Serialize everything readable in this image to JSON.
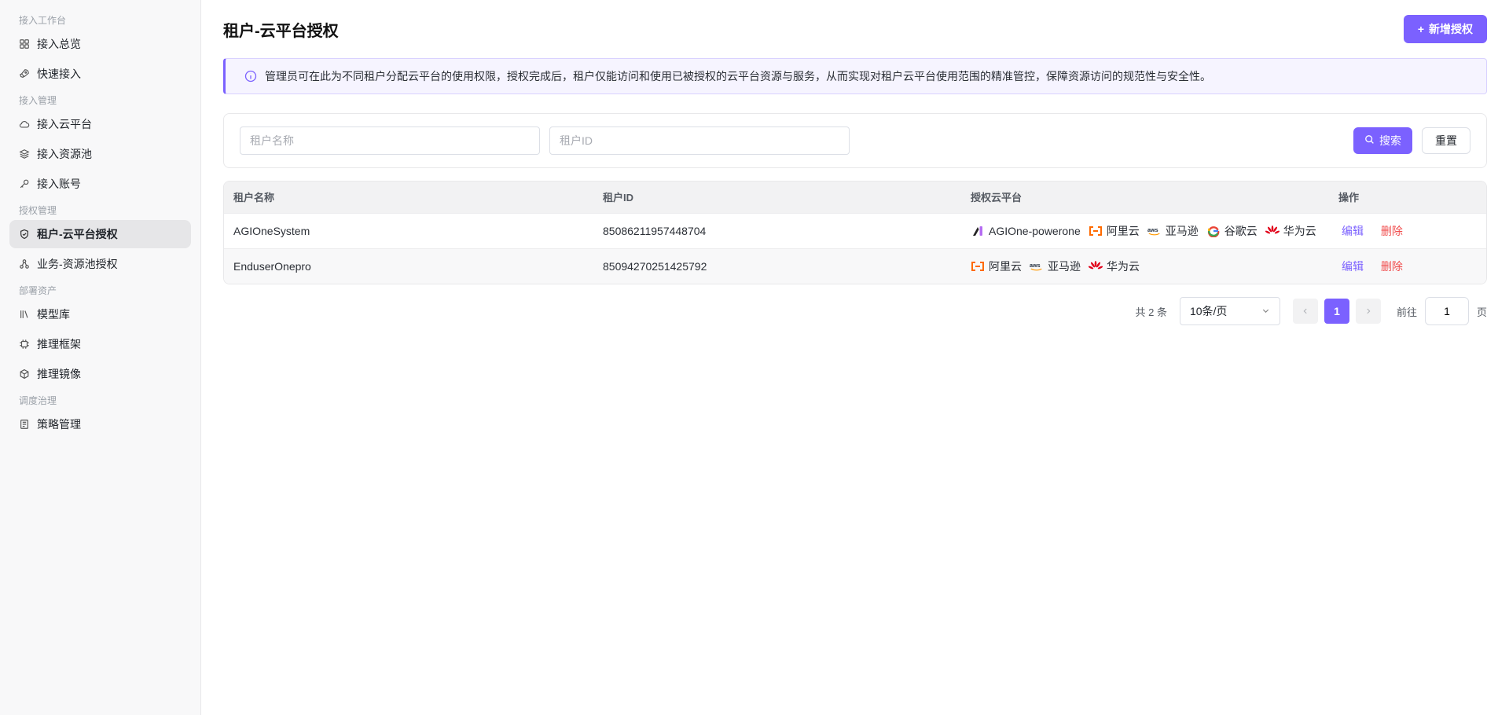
{
  "sidebar": {
    "groups": [
      {
        "title": "接入工作台",
        "items": [
          {
            "label": "接入总览",
            "icon": "grid-icon"
          },
          {
            "label": "快速接入",
            "icon": "rocket-icon"
          }
        ]
      },
      {
        "title": "接入管理",
        "items": [
          {
            "label": "接入云平台",
            "icon": "cloud-icon"
          },
          {
            "label": "接入资源池",
            "icon": "layers-icon"
          },
          {
            "label": "接入账号",
            "icon": "key-icon"
          }
        ]
      },
      {
        "title": "授权管理",
        "items": [
          {
            "label": "租户-云平台授权",
            "icon": "shield-icon",
            "active": true
          },
          {
            "label": "业务-资源池授权",
            "icon": "nodes-icon"
          }
        ]
      },
      {
        "title": "部署资产",
        "items": [
          {
            "label": "模型库",
            "icon": "library-icon"
          },
          {
            "label": "推理框架",
            "icon": "chip-icon"
          },
          {
            "label": "推理镜像",
            "icon": "box-icon"
          }
        ]
      },
      {
        "title": "调度治理",
        "items": [
          {
            "label": "策略管理",
            "icon": "policy-icon"
          }
        ]
      }
    ]
  },
  "header": {
    "title": "租户-云平台授权",
    "add_button": "新增授权"
  },
  "notice": "管理员可在此为不同租户分配云平台的使用权限，授权完成后，租户仅能访问和使用已被授权的云平台资源与服务，从而实现对租户云平台使用范围的精准管控，保障资源访问的规范性与安全性。",
  "search": {
    "tenant_name_placeholder": "租户名称",
    "tenant_id_placeholder": "租户ID",
    "search_button": "搜索",
    "reset_button": "重置"
  },
  "table": {
    "columns": [
      "租户名称",
      "租户ID",
      "授权云平台",
      "操作"
    ],
    "rows": [
      {
        "name": "AGIOneSystem",
        "id": "85086211957448704",
        "platforms": [
          "AGIOne-powerone",
          "阿里云",
          "亚马逊",
          "谷歌云",
          "华为云"
        ]
      },
      {
        "name": "EnduserOnepro",
        "id": "85094270251425792",
        "platforms": [
          "阿里云",
          "亚马逊",
          "华为云"
        ]
      }
    ],
    "edit_label": "编辑",
    "delete_label": "删除"
  },
  "pagination": {
    "total": "共 2 条",
    "page_size": "10条/页",
    "current_page": "1",
    "goto_prefix": "前往",
    "goto_value": "1",
    "goto_suffix": "页"
  },
  "colors": {
    "accent": "#7b61ff",
    "danger": "#f04b4b"
  }
}
